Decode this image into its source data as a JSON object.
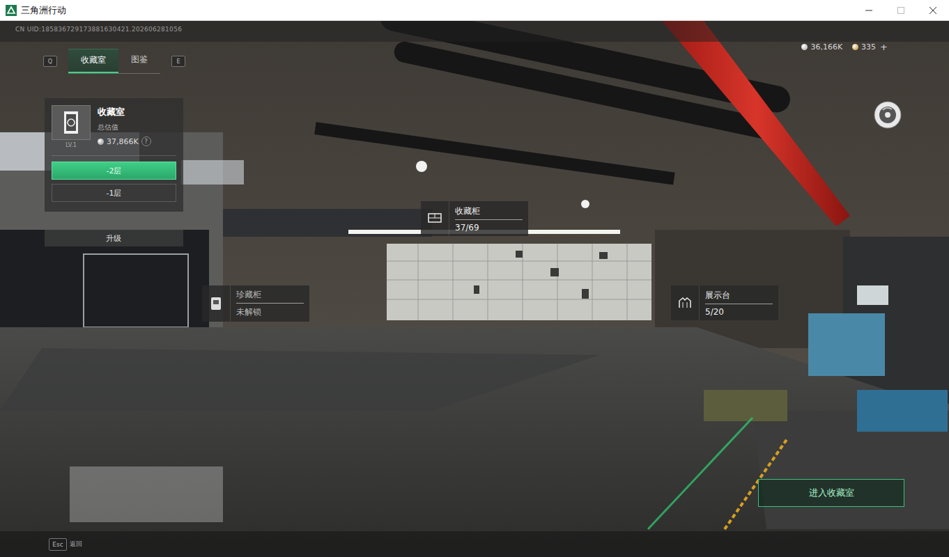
{
  "window": {
    "title": "三角洲行动"
  },
  "uid": "CN UID:185836729173881630421.202606281056",
  "tabs": {
    "prev_key": "Q",
    "next_key": "E",
    "items": [
      {
        "label": "收藏室",
        "selected": true
      },
      {
        "label": "图鉴",
        "selected": false
      }
    ]
  },
  "currency": [
    {
      "value": "36,166K",
      "color": "#c8c8c8"
    },
    {
      "value": "335",
      "color": "#d4b36a"
    }
  ],
  "add_button": "+",
  "room_panel": {
    "title": "收藏室",
    "subtitle": "总估值",
    "level": "LV.1",
    "value": "37,866K",
    "help": "?",
    "floors": [
      {
        "label": "-2层",
        "selected": true
      },
      {
        "label": "-1层",
        "selected": false
      }
    ],
    "upgrade": "升级"
  },
  "hotspots": [
    {
      "title": "收藏柜",
      "status": "37/69",
      "locked": false
    },
    {
      "title": "珍藏柜",
      "status": "未解锁",
      "locked": true
    },
    {
      "title": "展示台",
      "status": "5/20",
      "locked": false
    }
  ],
  "enter_button": "进入收藏室",
  "back": {
    "key": "Esc",
    "label": "返回"
  }
}
